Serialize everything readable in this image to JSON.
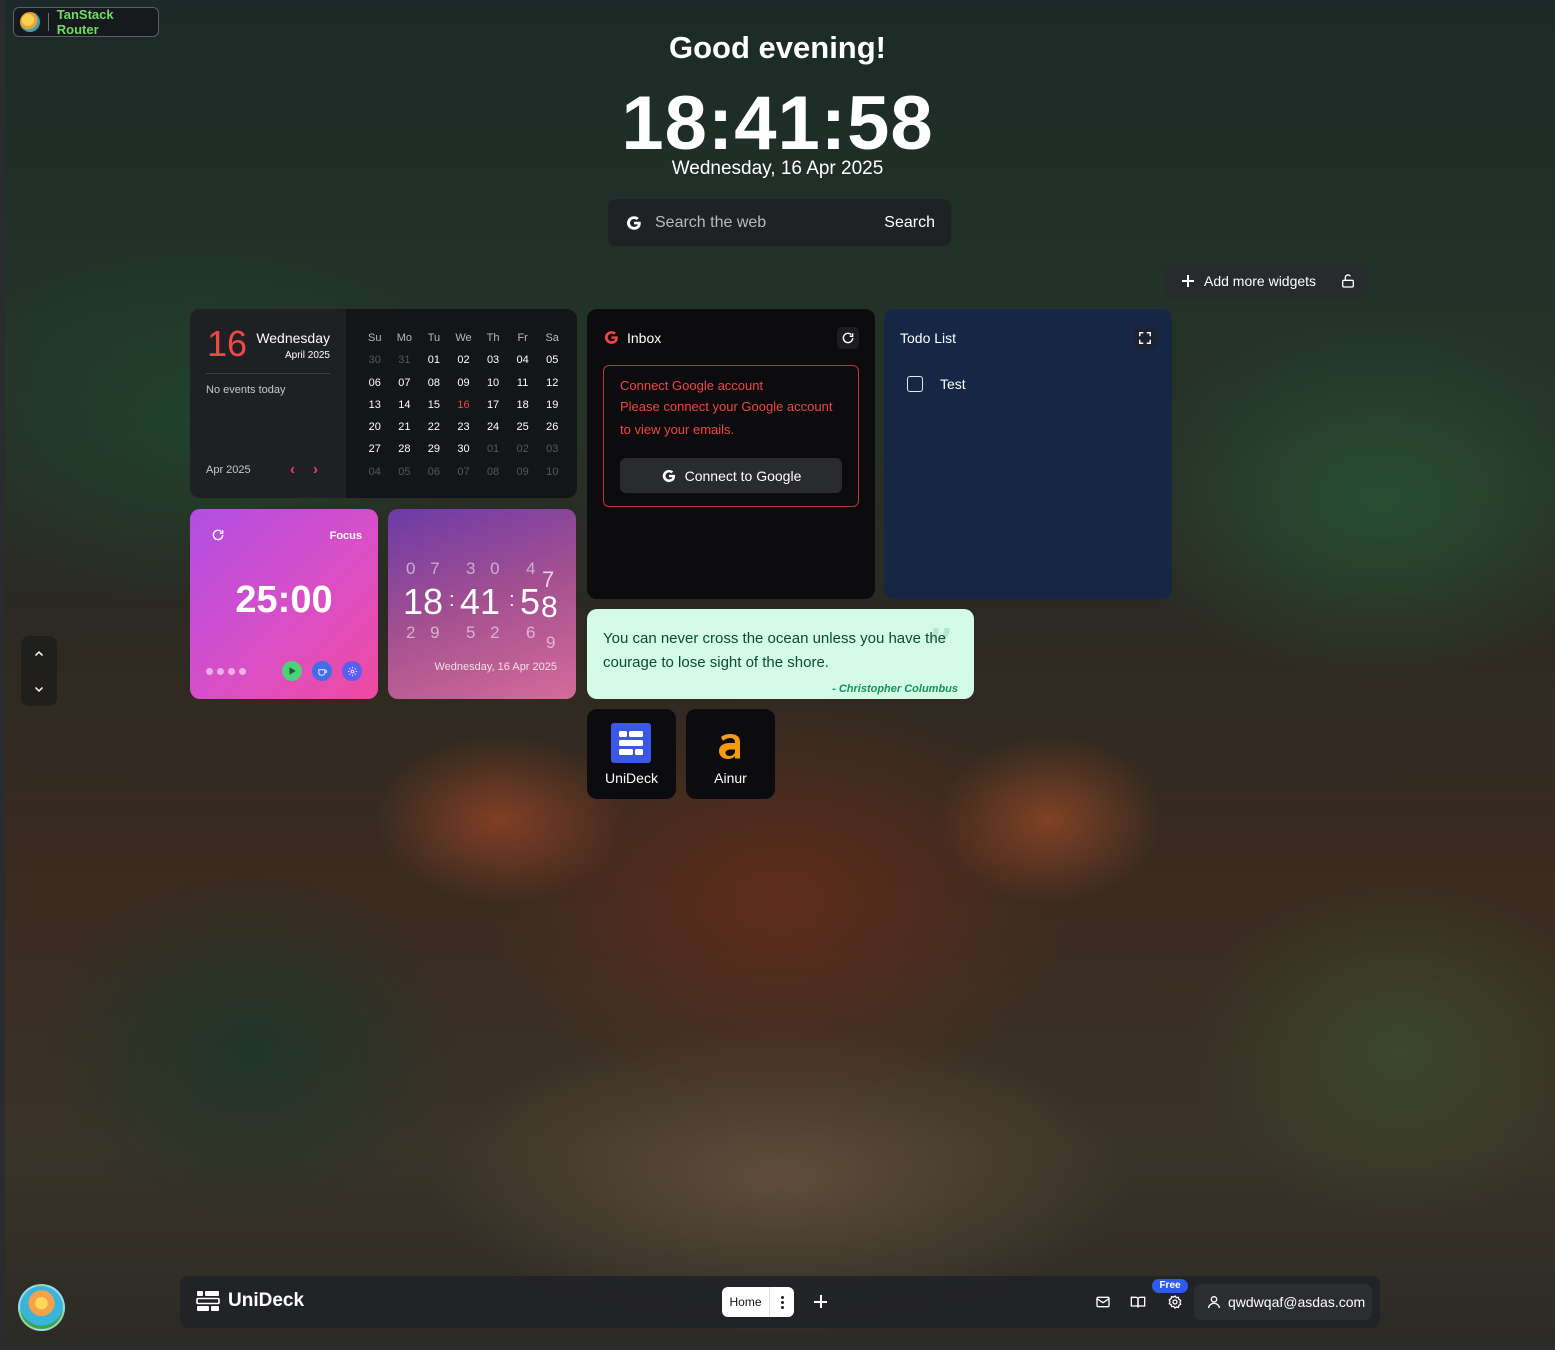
{
  "router_badge": {
    "label": "TanStack Router"
  },
  "header": {
    "greeting": "Good evening!",
    "time": "18:41:58",
    "date": "Wednesday, 16 Apr 2025"
  },
  "search": {
    "placeholder": "Search the web",
    "button_label": "Search",
    "icon": "google-g-icon"
  },
  "toolbar": {
    "add_widgets_label": "Add more widgets",
    "lock_icon": "unlock-icon"
  },
  "calendar": {
    "day_number": "16",
    "weekday": "Wednesday",
    "month_year": "April 2025",
    "no_events": "No events today",
    "footer_month": "Apr 2025",
    "prev_label": "‹",
    "next_label": "›",
    "weekdays": [
      "Su",
      "Mo",
      "Tu",
      "We",
      "Th",
      "Fr",
      "Sa"
    ],
    "weeks": [
      [
        "30",
        "31",
        "01",
        "02",
        "03",
        "04",
        "05"
      ],
      [
        "06",
        "07",
        "08",
        "09",
        "10",
        "11",
        "12"
      ],
      [
        "13",
        "14",
        "15",
        "16",
        "17",
        "18",
        "19"
      ],
      [
        "20",
        "21",
        "22",
        "23",
        "24",
        "25",
        "26"
      ],
      [
        "27",
        "28",
        "29",
        "30",
        "01",
        "02",
        "03"
      ],
      [
        "04",
        "05",
        "06",
        "07",
        "08",
        "09",
        "10"
      ]
    ],
    "today": "16",
    "accent_color": "#f04848"
  },
  "inbox": {
    "title": "Inbox",
    "alert_title": "Connect Google account",
    "alert_message": "Please connect your Google account to view your emails.",
    "connect_button": "Connect to Google"
  },
  "todo": {
    "title": "Todo List",
    "items": [
      {
        "label": "Test",
        "checked": false
      }
    ]
  },
  "focus": {
    "label": "Focus",
    "time": "25:00",
    "buttons": [
      "play-icon",
      "coffee-icon",
      "settings-icon"
    ]
  },
  "flip_clock": {
    "hour": "18",
    "minute": "41",
    "second_tens": "5",
    "second_ones": "8",
    "ghost_top": [
      "0 7",
      "3 0",
      "4"
    ],
    "ghost_bottom": [
      "2 9",
      "5 2",
      "6"
    ],
    "second_prev": "7",
    "second_next": "9",
    "date": "Wednesday, 16 Apr 2025"
  },
  "quote": {
    "text": "You can never cross the ocean unless you have the courage to lose sight of the shore.",
    "author": "- Christopher Columbus",
    "mark": "”"
  },
  "shortcuts": [
    {
      "label": "UniDeck",
      "icon": "unideck-icon"
    },
    {
      "label": "Ainur",
      "icon": "ainur-icon"
    }
  ],
  "dock": {
    "title": "UniDeck",
    "tab_home": "Home",
    "user_email": "qwdwqaf@asdas.com",
    "plan_badge": "Free",
    "icons": [
      "mail-icon",
      "book-icon",
      "settings-icon",
      "user-icon"
    ]
  },
  "colors": {
    "accent_red": "#f04848",
    "focus_gradient": [
      "#b14ee2",
      "#ef4aa0"
    ],
    "quote_bg": "#d3fbe6",
    "todo_bg": "#152744",
    "router_text": "#74d96a",
    "plan_badge": "#2f5bea"
  }
}
